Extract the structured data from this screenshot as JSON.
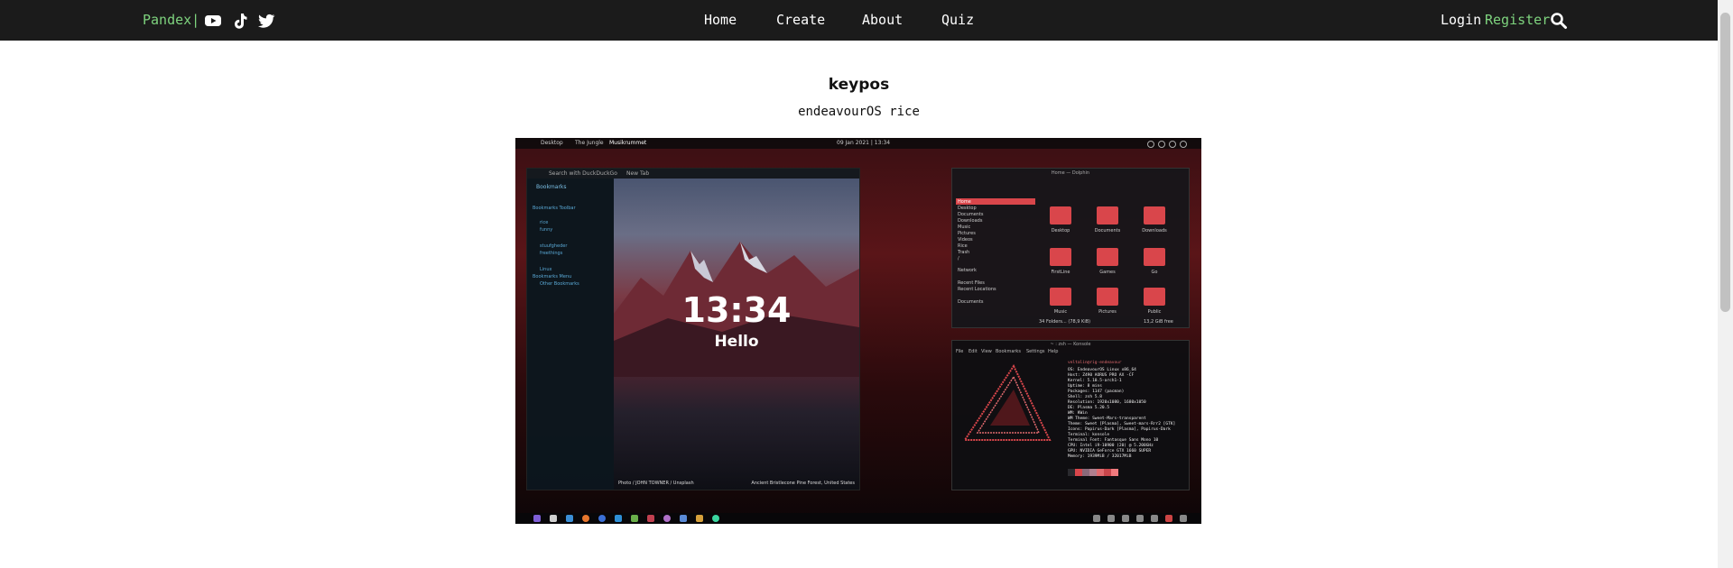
{
  "header": {
    "brand": "Pandex|",
    "nav": [
      "Home",
      "Create",
      "About",
      "Quiz"
    ],
    "login": "Login",
    "register": "Register"
  },
  "post": {
    "title": "keypos",
    "subtitle": "endeavourOS rice"
  },
  "screenshot": {
    "virtual_desktops": [
      "Desktop",
      "The Jungle",
      "Musikrummet"
    ],
    "top_clock": "09 Jan 2021  |  13:34",
    "browser": {
      "tab": "New Tab",
      "search_placeholder": "Search with DuckDuckGo",
      "sidebar_title": "Bookmarks",
      "bookmarks": [
        "Bookmarks Toolbar",
        "rice",
        "funny",
        "stuufgheder",
        "freethings",
        "Linux",
        "Bookmarks Menu",
        "Other Bookmarks"
      ],
      "lock_time": "13:34",
      "lock_greeting": "Hello",
      "photo_credit": "Photo / JOHN TOWNER / Unsplash",
      "location": "Ancient Bristlecone Pine Forest, United States"
    },
    "dolphin": {
      "title": "Home — Dolphin",
      "places": [
        "Home",
        "Desktop",
        "Documents",
        "Downloads",
        "Music",
        "Pictures",
        "Videos",
        "Rice",
        "Trash",
        "/",
        "Network",
        "Recent Files",
        "Recent Locations",
        "Documents"
      ],
      "folders": [
        "Desktop",
        "Documents",
        "Downloads",
        "FirstLine",
        "Games",
        "Go",
        "Music",
        "Pictures",
        "Public"
      ],
      "status": "34 Folders... (78,9 KiB)",
      "free": "13,2 GiB free"
    },
    "konsole": {
      "title": "~ : zsh — Konsole",
      "menu": [
        "File",
        "Edit",
        "View",
        "Bookmarks",
        "Settings",
        "Help"
      ],
      "user_host": "veltalin@rig-endeavour",
      "info": [
        "OS: EndeavourOS Linux x86_64",
        "Host: Z490 AORUS PRO AX -CF",
        "Kernel: 5.10.5-arch1-1",
        "Uptime: 8 mins",
        "Packages: 1147 (pacman)",
        "Shell: zsh 5.8",
        "Resolution: 1920x1080, 1680x1050",
        "DE: Plasma 5.20.5",
        "WM: KWin",
        "WM Theme: Sweet-Mars-transparent",
        "Theme: Sweet [Plasma], Sweet-mars-Rrr2 [GTK]",
        "Icons: Papirus-Dark [Plasma], Papirus-Dark",
        "Terminal: konsole",
        "Terminal Font: Fantasque Sans Mono 10",
        "CPU: Intel i9-10900 (20) @ 5.200GHz",
        "GPU: NVIDIA GeForce GTX 1660 SUPER",
        "Memory: 1939MiB / 32017MiB"
      ]
    }
  }
}
